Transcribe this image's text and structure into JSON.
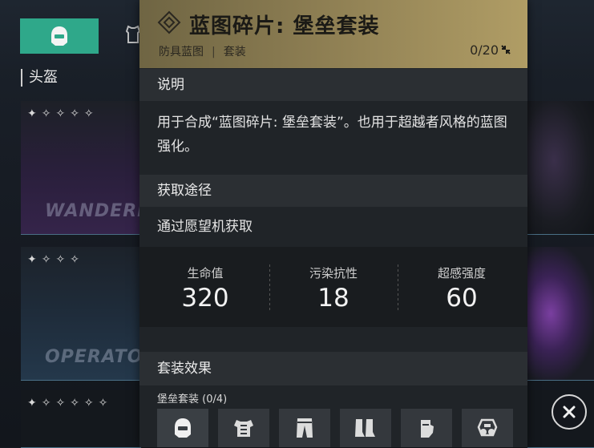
{
  "background": {
    "section_label": "头盔",
    "cards": [
      {
        "stars": "✦✧✧✧✧",
        "brand": "WANDERE"
      },
      {
        "stars": "✦✧✧✧",
        "brand": "OPERATO"
      },
      {
        "stars": "✦✧✧✧✧✧"
      }
    ]
  },
  "popup": {
    "title": "蓝图碎片: 堡垒套装",
    "tags": [
      "防具蓝图",
      "套装"
    ],
    "count": "0/20",
    "description_heading": "说明",
    "description": "用于合成“蓝图碎片: 堡垒套装”。也用于超越者风格的蓝图强化。",
    "source_heading": "获取途径",
    "source": "通过愿望机获取",
    "stats": [
      {
        "label": "生命值",
        "value": "320"
      },
      {
        "label": "污染抗性",
        "value": "18"
      },
      {
        "label": "超感强度",
        "value": "60"
      }
    ],
    "set_heading": "套装效果",
    "set_progress": "堡垒套装 (0/4)",
    "set_slots": [
      "helmet-icon",
      "armor-icon",
      "pants-icon",
      "boots-icon",
      "gloves-icon",
      "mask-icon"
    ]
  },
  "colors": {
    "accent_green": "#2fa88a",
    "header_gold": "#b09d65"
  }
}
